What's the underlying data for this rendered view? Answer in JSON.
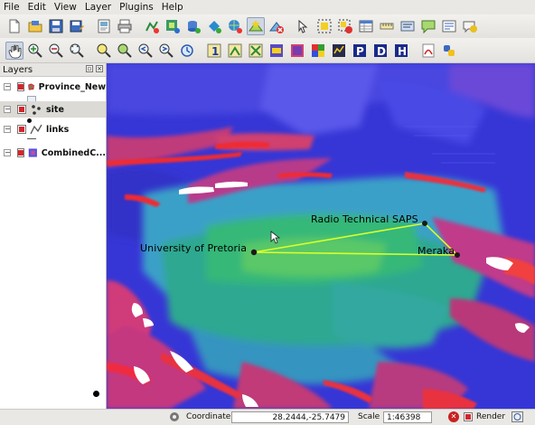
{
  "menu": [
    "File",
    "Edit",
    "View",
    "Layer",
    "Plugins",
    "Help"
  ],
  "toolbar1": [
    "new-project-icon",
    "open-project-icon",
    "save-project-icon",
    "save-as-icon",
    "print-composer-icon",
    "print-icon",
    "add-vector-layer-icon",
    "add-raster-layer-icon",
    "add-postgis-icon",
    "add-spatialite-icon",
    "add-wms-icon",
    "new-layer-icon",
    "remove-layer-icon",
    "capture-point-icon",
    "select-features-icon",
    "deselect-icon",
    "attribute-table-icon",
    "measure-icon",
    "identify-icon",
    "map-tips-icon",
    "bookmark-icon",
    "help-icon"
  ],
  "toolbar2": [
    "pan-icon",
    "zoom-in-icon",
    "zoom-out-icon",
    "zoom-full-icon",
    "zoom-selection-icon",
    "zoom-layer-icon",
    "zoom-last-icon",
    "zoom-next-icon",
    "refresh-icon",
    "plugin-1-icon",
    "plugin-2-icon",
    "plugin-3-icon",
    "plugin-4-icon",
    "plugin-5-icon",
    "plugin-6-icon",
    "plugin-7-icon",
    "plugin-p-icon",
    "plugin-d-icon",
    "plugin-h-icon",
    "pdf-icon",
    "python-icon"
  ],
  "plugin_letters": {
    "one": "1",
    "p": "P",
    "d": "D",
    "h": "H"
  },
  "layers_panel": {
    "title": "Layers",
    "items": [
      {
        "label": "Province_New",
        "icon": "polygon-layer-icon"
      },
      {
        "label": "site",
        "icon": "point-layer-icon"
      },
      {
        "label": "links",
        "icon": "line-layer-icon"
      },
      {
        "label": "CombinedC...",
        "icon": "raster-layer-icon"
      }
    ]
  },
  "map": {
    "labels": {
      "university": "University of Pretoria",
      "radio": "Radio Technical SAPS",
      "meraka": "Meraka"
    },
    "colors": {
      "link": "#d8ff2a",
      "site": "#1a1a1a"
    }
  },
  "status": {
    "coordinate_label": "Coordinate:",
    "coordinate_value": "28.2444,-25.7479",
    "scale_label": "Scale",
    "scale_value": "1:46398",
    "render_label": "Render"
  }
}
